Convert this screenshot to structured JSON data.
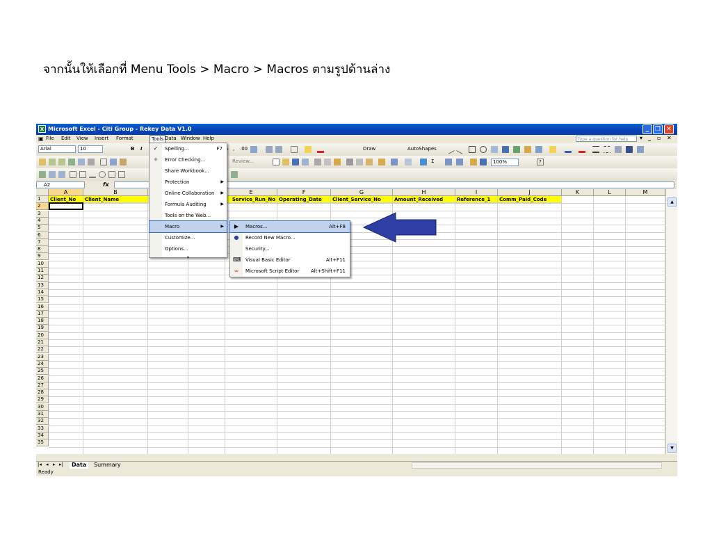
{
  "caption": "จากนั้นให้เลือกที่ Menu Tools > Macro > Macros ตามรูปด้านล่าง",
  "window": {
    "title": "Microsoft Excel - Citi Group - Rekey Data V1.0",
    "icon": "excel-icon"
  },
  "menubar": {
    "items": [
      "File",
      "Edit",
      "View",
      "Insert",
      "Format",
      "Tools",
      "Data",
      "Window",
      "Help"
    ],
    "active": "Tools",
    "help_placeholder": "Type a question for help"
  },
  "toolbar": {
    "font": "Arial",
    "size": "10",
    "bold": "B",
    "italic": "I",
    "percent": "%",
    "comma": ",",
    "inc_decimal": ".00",
    "draw": "Draw",
    "autoshapes": "AutoShapes",
    "review": "Review...",
    "sigma": "Σ",
    "zoom": "100%",
    "help_icon": "?"
  },
  "formula_bar": {
    "name_box": "A2",
    "fx": "fx",
    "value": ""
  },
  "grid": {
    "columns": [
      "A",
      "B",
      "C",
      "D",
      "E",
      "F",
      "G",
      "H",
      "I",
      "J",
      "K",
      "L",
      "M"
    ],
    "selected_column": "A",
    "header_row": [
      "Client_No",
      "Client_Name",
      "",
      "",
      "Service_Run_No",
      "Operating_Date",
      "Client_Service_No",
      "Amount_Received",
      "Reference_1",
      "Comm_Paid_Code"
    ],
    "rows": [
      "1",
      "2",
      "3",
      "4",
      "5",
      "6",
      "7",
      "8",
      "9",
      "10",
      "11",
      "12",
      "13",
      "14",
      "15",
      "16",
      "17",
      "18",
      "19",
      "20",
      "21",
      "22",
      "23",
      "24",
      "25",
      "26",
      "27",
      "28",
      "29",
      "30",
      "31",
      "32",
      "33",
      "34",
      "35"
    ],
    "selected_row": "2"
  },
  "tools_menu": {
    "items": [
      {
        "label": "Spelling...",
        "shortcut": "F7",
        "icon": "spelling-icon"
      },
      {
        "label": "Error Checking...",
        "icon": "error-check-icon"
      },
      {
        "label": "Share Workbook..."
      },
      {
        "label": "Protection",
        "submenu": true
      },
      {
        "label": "Online Collaboration",
        "submenu": true
      },
      {
        "label": "Formula Auditing",
        "submenu": true
      },
      {
        "label": "Tools on the Web..."
      },
      {
        "label": "Macro",
        "submenu": true
      },
      {
        "label": "Customize..."
      },
      {
        "label": "Options..."
      }
    ],
    "expand": "»"
  },
  "macro_submenu": {
    "items": [
      {
        "label": "Macros...",
        "shortcut": "Alt+F8",
        "icon": "play-icon"
      },
      {
        "label": "Record New Macro...",
        "icon": "record-icon"
      },
      {
        "label": "Security..."
      },
      {
        "label": "Visual Basic Editor",
        "shortcut": "Alt+F11",
        "icon": "vb-editor-icon"
      },
      {
        "label": "Microsoft Script Editor",
        "shortcut": "Alt+Shift+F11",
        "icon": "script-editor-icon"
      }
    ]
  },
  "sheet_tabs": {
    "tabs": [
      "Data",
      "Summary"
    ],
    "active": "Data"
  },
  "status": "Ready",
  "colors": {
    "titlebar": "#0842b0",
    "header_fill": "#ffff00",
    "highlight": "#c1d2ee",
    "arrow": "#2d3fa3"
  }
}
